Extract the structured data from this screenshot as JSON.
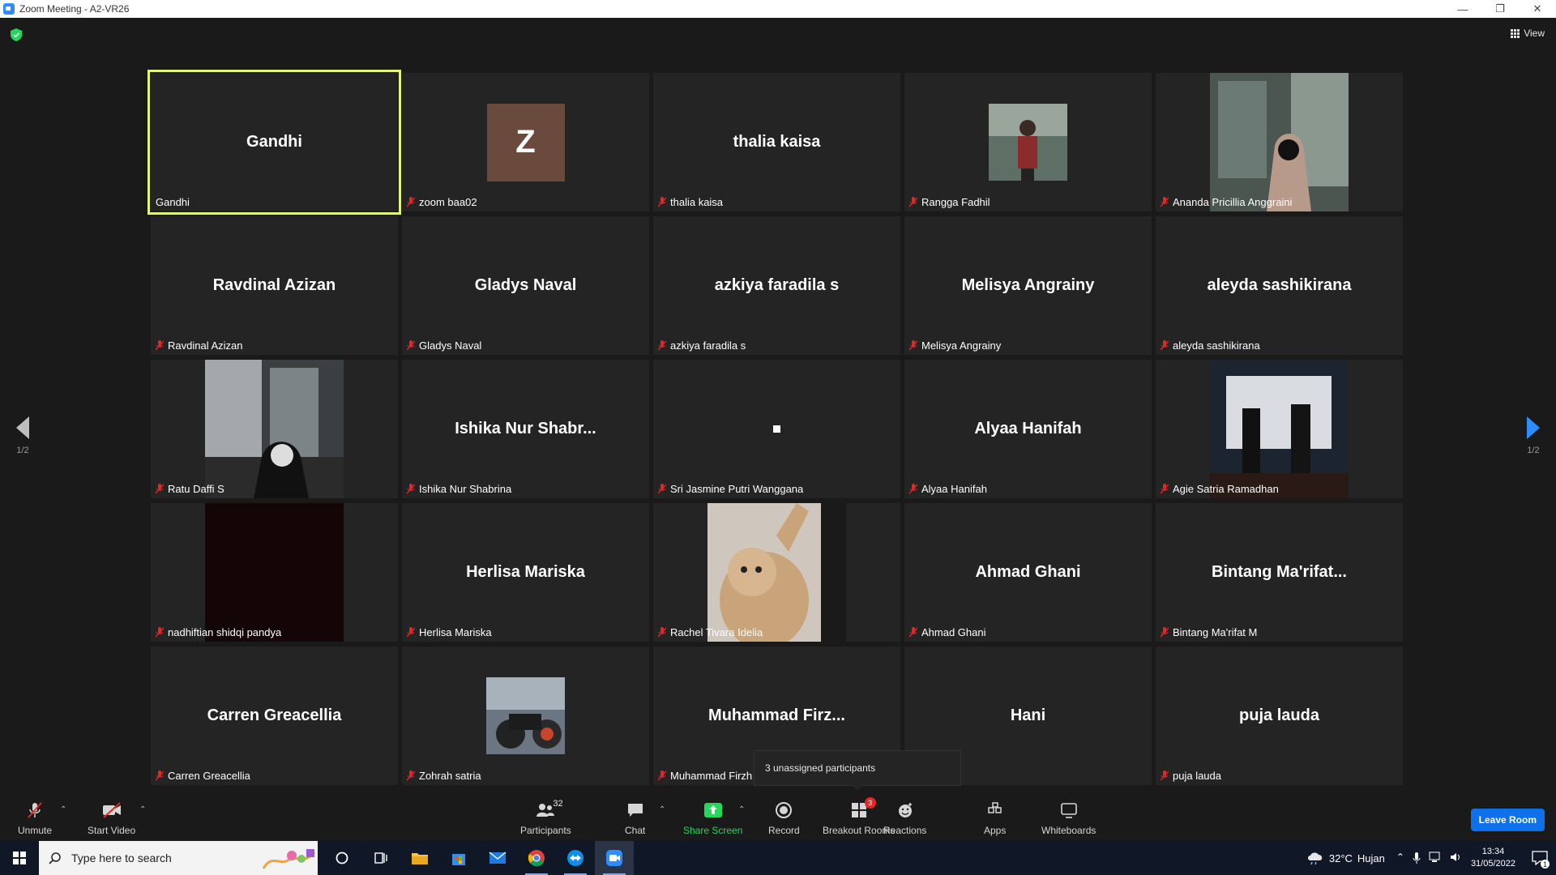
{
  "window": {
    "title": "Zoom Meeting - A2-VR26",
    "controls": [
      "—",
      "❐",
      "✕"
    ]
  },
  "top": {
    "view_label": "View"
  },
  "pager": {
    "left_label": "1/2",
    "right_label": "1/2"
  },
  "tiles": [
    {
      "big": "Gandhi",
      "tag": "Gandhi",
      "muted": false,
      "active": true,
      "kind": "name"
    },
    {
      "big": "Z",
      "tag": "zoom baa02",
      "muted": true,
      "kind": "letter"
    },
    {
      "big": "thalia kaisa",
      "tag": "thalia kaisa",
      "muted": true,
      "kind": "name"
    },
    {
      "big": "",
      "tag": "Rangga Fadhil",
      "muted": true,
      "kind": "photo-square"
    },
    {
      "big": "",
      "tag": "Ananda Pricillia Anggraini",
      "muted": true,
      "kind": "photo-wide"
    },
    {
      "big": "Ravdinal Azizan",
      "tag": "Ravdinal Azizan",
      "muted": true,
      "kind": "name"
    },
    {
      "big": "Gladys Naval",
      "tag": "Gladys Naval",
      "muted": true,
      "kind": "name"
    },
    {
      "big": "azkiya faradila s",
      "tag": "azkiya faradila s",
      "muted": true,
      "kind": "name"
    },
    {
      "big": "Melisya Angrainy",
      "tag": "Melisya Angrainy",
      "muted": true,
      "kind": "name"
    },
    {
      "big": "aleyda sashikirana",
      "tag": "aleyda sashikirana",
      "muted": true,
      "kind": "name"
    },
    {
      "big": "",
      "tag": "Ratu Daffi S",
      "muted": true,
      "kind": "photo-wide"
    },
    {
      "big": "Ishika Nur Shabr...",
      "tag": "Ishika Nur Shabrina",
      "muted": true,
      "kind": "name"
    },
    {
      "big": "",
      "tag": "Sri Jasmine Putri Wanggana",
      "muted": true,
      "kind": "dot"
    },
    {
      "big": "Alyaa Hanifah",
      "tag": "Alyaa Hanifah",
      "muted": true,
      "kind": "name"
    },
    {
      "big": "",
      "tag": "Agie Satria Ramadhan",
      "muted": true,
      "kind": "photo-wide"
    },
    {
      "big": "",
      "tag": "nadhiftian shidqi pandya",
      "muted": true,
      "kind": "photo-wide"
    },
    {
      "big": "Herlisa Mariska",
      "tag": "Herlisa Mariska",
      "muted": true,
      "kind": "name"
    },
    {
      "big": "",
      "tag": "Rachel Tivara Idelia",
      "muted": true,
      "kind": "photo-wide"
    },
    {
      "big": "Ahmad Ghani",
      "tag": "Ahmad Ghani",
      "muted": true,
      "kind": "name"
    },
    {
      "big": "Bintang  Ma'rifat...",
      "tag": "Bintang Ma'rifat M",
      "muted": true,
      "kind": "name"
    },
    {
      "big": "Carren Greacellia",
      "tag": "Carren Greacellia",
      "muted": true,
      "kind": "name"
    },
    {
      "big": "",
      "tag": "Zohrah satria",
      "muted": true,
      "kind": "photo-square"
    },
    {
      "big": "Muhammad  Firz...",
      "tag": "Muhammad Firzh",
      "muted": true,
      "kind": "name"
    },
    {
      "big": "Hani",
      "tag": "",
      "muted": false,
      "kind": "name"
    },
    {
      "big": "puja lauda",
      "tag": "puja lauda",
      "muted": true,
      "kind": "name"
    }
  ],
  "tooltip": {
    "text": "3 unassigned participants"
  },
  "toolbar": {
    "unmute": "Unmute",
    "start_video": "Start Video",
    "participants": "Participants",
    "participant_count": "32",
    "chat": "Chat",
    "share_screen": "Share Screen",
    "record": "Record",
    "breakout_rooms": "Breakout Rooms",
    "breakout_badge": "3",
    "reactions": "Reactions",
    "apps": "Apps",
    "whiteboards": "Whiteboards",
    "leave": "Leave Room"
  },
  "taskbar": {
    "search_placeholder": "Type here to search",
    "weather_temp": "32°C",
    "weather_desc": "Hujan",
    "time": "13:34",
    "date": "31/05/2022",
    "notif_count": "1"
  },
  "colors": {
    "active_border": "#e1f47c",
    "share_green": "#23d959",
    "leave_blue": "#0e71eb",
    "badge_red": "#e02828"
  }
}
